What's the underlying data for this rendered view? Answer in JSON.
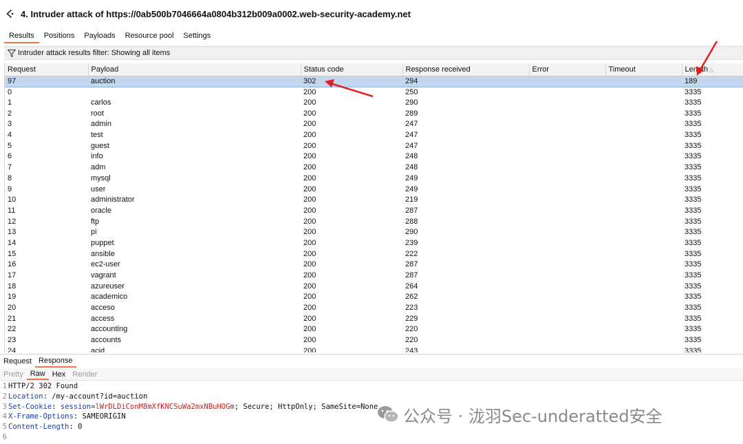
{
  "window": {
    "title": "4. Intruder attack of https://0ab500b7046664a0804b312b009a0002.web-security-academy.net"
  },
  "tabs": [
    "Results",
    "Positions",
    "Payloads",
    "Resource pool",
    "Settings"
  ],
  "filter": {
    "label": "Intruder attack results filter: Showing all items"
  },
  "columns": [
    "Request",
    "Payload",
    "Status code",
    "Response received",
    "Error",
    "Timeout",
    "Length"
  ],
  "rows": [
    [
      "97",
      "auction",
      "302",
      "294",
      "",
      "",
      "189"
    ],
    [
      "0",
      "",
      "200",
      "250",
      "",
      "",
      "3335"
    ],
    [
      "1",
      "carlos",
      "200",
      "290",
      "",
      "",
      "3335"
    ],
    [
      "2",
      "root",
      "200",
      "289",
      "",
      "",
      "3335"
    ],
    [
      "3",
      "admin",
      "200",
      "247",
      "",
      "",
      "3335"
    ],
    [
      "4",
      "test",
      "200",
      "247",
      "",
      "",
      "3335"
    ],
    [
      "5",
      "guest",
      "200",
      "247",
      "",
      "",
      "3335"
    ],
    [
      "6",
      "info",
      "200",
      "248",
      "",
      "",
      "3335"
    ],
    [
      "7",
      "adm",
      "200",
      "248",
      "",
      "",
      "3335"
    ],
    [
      "8",
      "mysql",
      "200",
      "249",
      "",
      "",
      "3335"
    ],
    [
      "9",
      "user",
      "200",
      "249",
      "",
      "",
      "3335"
    ],
    [
      "10",
      "administrator",
      "200",
      "219",
      "",
      "",
      "3335"
    ],
    [
      "11",
      "oracle",
      "200",
      "287",
      "",
      "",
      "3335"
    ],
    [
      "12",
      "ftp",
      "200",
      "288",
      "",
      "",
      "3335"
    ],
    [
      "13",
      "pi",
      "200",
      "290",
      "",
      "",
      "3335"
    ],
    [
      "14",
      "puppet",
      "200",
      "239",
      "",
      "",
      "3335"
    ],
    [
      "15",
      "ansible",
      "200",
      "222",
      "",
      "",
      "3335"
    ],
    [
      "16",
      "ec2-user",
      "200",
      "287",
      "",
      "",
      "3335"
    ],
    [
      "17",
      "vagrant",
      "200",
      "287",
      "",
      "",
      "3335"
    ],
    [
      "18",
      "azureuser",
      "200",
      "264",
      "",
      "",
      "3335"
    ],
    [
      "19",
      "academico",
      "200",
      "262",
      "",
      "",
      "3335"
    ],
    [
      "20",
      "acceso",
      "200",
      "223",
      "",
      "",
      "3335"
    ],
    [
      "21",
      "access",
      "200",
      "229",
      "",
      "",
      "3335"
    ],
    [
      "22",
      "accounting",
      "200",
      "220",
      "",
      "",
      "3335"
    ],
    [
      "23",
      "accounts",
      "200",
      "220",
      "",
      "",
      "3335"
    ],
    [
      "24",
      "acid",
      "200",
      "243",
      "",
      "",
      "3335"
    ]
  ],
  "bottom_tabs": [
    "Request",
    "Response"
  ],
  "sub_tabs": [
    "Pretty",
    "Raw",
    "Hex",
    "Render"
  ],
  "response": {
    "lines": [
      {
        "num": "1",
        "key": "HTTP/2 302 Found",
        "sep": "",
        "value": "",
        "extra": ""
      },
      {
        "num": "2",
        "key": "Location",
        "sep": ": ",
        "value": "/my-account?id=auction",
        "extra": ""
      },
      {
        "num": "3",
        "key": "Set-Cookie",
        "sep": ": ",
        "value": "session=",
        "cookie": "lWrDLDiConM8mXfKNCSuWa2mxNBuHOGm",
        "extra": "; Secure; HttpOnly; SameSite=None"
      },
      {
        "num": "4",
        "key": "X-Frame-Options",
        "sep": ": ",
        "value": "SAMEORIGIN",
        "extra": ""
      },
      {
        "num": "5",
        "key": "Content-Length",
        "sep": ": ",
        "value": "0",
        "extra": ""
      },
      {
        "num": "6",
        "key": "",
        "sep": "",
        "value": "",
        "extra": ""
      }
    ]
  },
  "watermark": {
    "text": "公众号 · 泷羽Sec-underatted安全"
  },
  "colors": {
    "accent": "#e8774d",
    "selected_row": "#c3d7ee",
    "arrow": "#e02020",
    "header_key": "#1b3fa8"
  }
}
